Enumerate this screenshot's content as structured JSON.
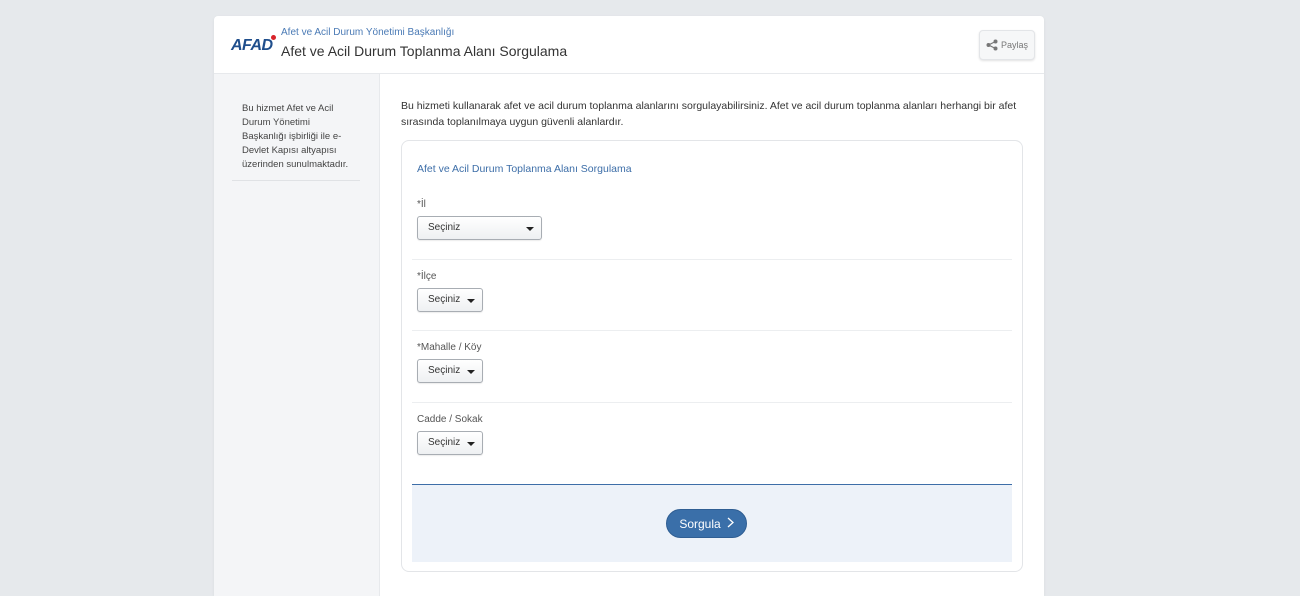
{
  "header": {
    "logo": "AFAD",
    "agency": "Afet ve Acil Durum Yönetimi Başkanlığı",
    "title": "Afet ve Acil Durum Toplanma Alanı Sorgulama",
    "share_label": "Paylaş"
  },
  "sidebar": {
    "info": "Bu hizmet Afet ve Acil Durum Yönetimi Başkanlığı işbirliği ile e-Devlet Kapısı altyapısı üzerinden sunulmaktadır."
  },
  "main": {
    "intro": "Bu hizmeti kullanarak afet ve acil durum toplanma alanlarını sorgulayabilirsiniz. Afet ve acil durum toplanma alanları herhangi bir afet sırasında toplanılmaya uygun güvenli alanlardır."
  },
  "form": {
    "title": "Afet ve Acil Durum Toplanma Alanı Sorgulama",
    "fields": [
      {
        "label": "*İl",
        "value": "Seçiniz"
      },
      {
        "label": "*İlçe",
        "value": "Seçiniz"
      },
      {
        "label": "*Mahalle / Köy",
        "value": "Seçiniz"
      },
      {
        "label": "Cadde / Sokak",
        "value": "Seçiniz"
      }
    ],
    "submit_label": "Sorgula"
  },
  "icons": {
    "share": "share-icon",
    "chevron": "chevron-right-icon"
  },
  "colors": {
    "accent": "#3a6fa9",
    "logo_red": "#d8232a",
    "background": "#e6e9ec"
  }
}
